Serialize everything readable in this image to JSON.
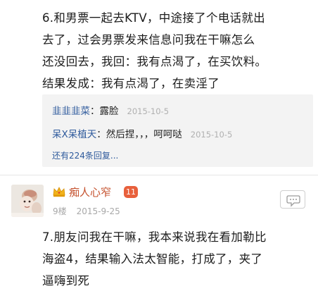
{
  "post1": {
    "lines": [
      "6.和男票一起去KTV，中途接了个电话就出",
      "去了，过会男票发来信息问我在干嘛怎么",
      "还没回去，我回：我有点渴了，在买饮料。",
      "结果发成：我有点渴了，在卖淫了"
    ]
  },
  "replies": [
    {
      "user": "韭韭韭菜",
      "text": "：露脸",
      "time": "2015-10-5"
    },
    {
      "user": "呆X呆植天",
      "text": "：然后捏，，，呵呵哒",
      "time": "2015-10-5"
    }
  ],
  "more_replies_label": "还有224条回复...",
  "floor2": {
    "username": "痴人心窄",
    "level": "11",
    "floor": "9楼",
    "date": "2015-9-25",
    "lines": [
      "7.朋友问我在干嘛，我本来说我在看加勒比",
      "海盗4，结果输入法太智能，打成了，夹了",
      "逼嗨到死"
    ]
  },
  "colors": {
    "link_blue": "#2e5a9c",
    "username_orange": "#c4502c",
    "badge_red": "#e8603c",
    "meta_gray": "#a8a8a8"
  }
}
